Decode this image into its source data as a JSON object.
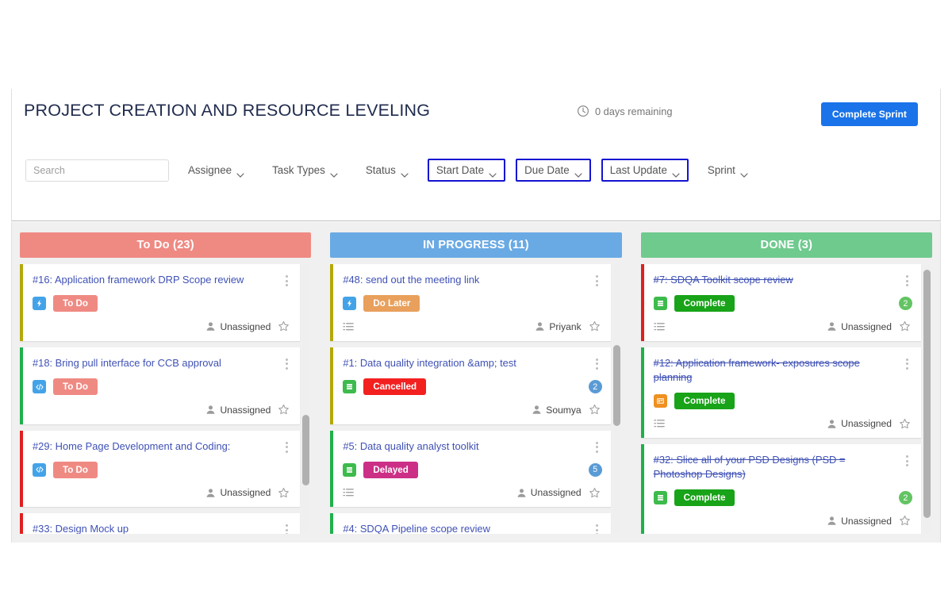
{
  "header": {
    "project_title": "PROJECT CREATION AND RESOURCE LEVELING",
    "days_remaining": "0 days remaining",
    "clock_icon": "clock-icon",
    "complete_sprint_label": "Complete Sprint",
    "accent_color": "#1a73e8"
  },
  "filters": {
    "search": {
      "value": "",
      "placeholder": "Search",
      "icon": "search-icon"
    },
    "items": [
      {
        "label": "Assignee",
        "highlighted": false
      },
      {
        "label": "Task Types",
        "highlighted": false
      },
      {
        "label": "Status",
        "highlighted": false
      },
      {
        "label": "Start Date",
        "highlighted": true
      },
      {
        "label": "Due Date",
        "highlighted": true
      },
      {
        "label": "Last Update",
        "highlighted": true
      },
      {
        "label": "Sprint",
        "highlighted": false
      }
    ],
    "highlight_color": "#1414d2"
  },
  "board": {
    "columns": [
      {
        "title": "To Do (23)",
        "header_color": "#ef8a83",
        "scrollbar": {
          "top_pct": 56,
          "height_pct": 26
        },
        "cards": [
          {
            "title": "#16: Application framework DRP Scope review",
            "accent": "#b3a80a",
            "type_icon": "bolt-icon",
            "type_icon_color": "#44a3e8",
            "status": "To Do",
            "status_color": "#ef8a83",
            "assignee": "Unassigned",
            "count": "",
            "count_color": "",
            "has_description": false,
            "done": false
          },
          {
            "title": "#18: Bring pull interface for CCB approval",
            "accent": "#20b04b",
            "type_icon": "code-icon",
            "type_icon_color": "#44a3e8",
            "status": "To Do",
            "status_color": "#ef8a83",
            "assignee": "Unassigned",
            "count": "",
            "count_color": "",
            "has_description": false,
            "done": false
          },
          {
            "title": "#29: Home Page Development and Coding:",
            "accent": "#e02020",
            "type_icon": "code-icon",
            "type_icon_color": "#44a3e8",
            "status": "To Do",
            "status_color": "#ef8a83",
            "assignee": "Unassigned",
            "count": "",
            "count_color": "",
            "has_description": false,
            "done": false
          },
          {
            "title": "#33: Design Mock up",
            "accent": "#e02020",
            "type_icon": "",
            "type_icon_color": "",
            "status": "",
            "status_color": "",
            "assignee": "",
            "count": "",
            "count_color": "",
            "has_description": false,
            "done": false
          }
        ]
      },
      {
        "title": "IN PROGRESS (11)",
        "header_color": "#6aaae4",
        "scrollbar": {
          "top_pct": 30,
          "height_pct": 30
        },
        "cards": [
          {
            "title": "#48: send out the meeting link",
            "accent": "#b3a80a",
            "type_icon": "bolt-icon",
            "type_icon_color": "#44a3e8",
            "status": "Do Later",
            "status_color": "#e8a05c",
            "assignee": "Priyank",
            "count": "",
            "count_color": "",
            "has_description": true,
            "done": false
          },
          {
            "title": "#1: Data quality integration &amp; test",
            "accent": "#b3a80a",
            "type_icon": "stack-icon",
            "type_icon_color": "#3dbb4c",
            "status": "Cancelled",
            "status_color": "#f32020",
            "assignee": "Soumya",
            "count": "2",
            "count_color": "#5a9bd5",
            "has_description": false,
            "done": false
          },
          {
            "title": "#5: Data quality analyst toolkit",
            "accent": "#20b04b",
            "type_icon": "stack-icon",
            "type_icon_color": "#3dbb4c",
            "status": "Delayed",
            "status_color": "#cc2f86",
            "assignee": "Unassigned",
            "count": "5",
            "count_color": "#5a9bd5",
            "has_description": true,
            "done": false
          },
          {
            "title": "#4: SDQA Pipeline scope review",
            "accent": "#20b04b",
            "type_icon": "",
            "type_icon_color": "",
            "status": "",
            "status_color": "",
            "assignee": "",
            "count": "",
            "count_color": "",
            "has_description": false,
            "done": false
          }
        ]
      },
      {
        "title": "DONE (3)",
        "header_color": "#6fca8e",
        "scrollbar": {
          "top_pct": 2,
          "height_pct": 92
        },
        "cards": [
          {
            "title": "#7: SDQA Toolkit scope review",
            "accent": "#e02020",
            "type_icon": "stack-icon",
            "type_icon_color": "#3dbb4c",
            "status": "Complete",
            "status_color": "#18a318",
            "assignee": "Unassigned",
            "count": "2",
            "count_color": "#62c462",
            "has_description": true,
            "done": true
          },
          {
            "title": "#12: Application framework- exposures scope planning",
            "accent": "#20b04b",
            "type_icon": "board-icon",
            "type_icon_color": "#ef9020",
            "status": "Complete",
            "status_color": "#18a318",
            "assignee": "Unassigned",
            "count": "",
            "count_color": "",
            "has_description": true,
            "done": true
          },
          {
            "title": "#32: Slice all of your PSD Designs (PSD = Photoshop Designs)",
            "accent": "#20b04b",
            "type_icon": "stack-icon",
            "type_icon_color": "#3dbb4c",
            "status": "Complete",
            "status_color": "#18a318",
            "assignee": "Unassigned",
            "count": "2",
            "count_color": "#62c462",
            "has_description": false,
            "done": true
          }
        ]
      }
    ]
  }
}
